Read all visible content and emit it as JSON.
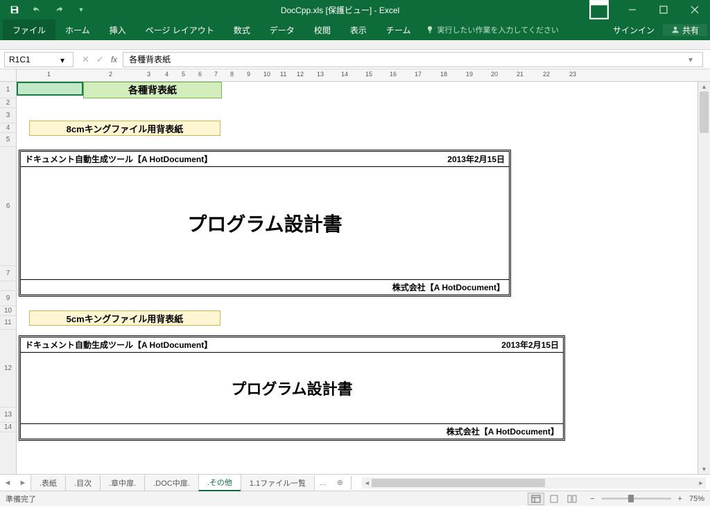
{
  "titlebar": {
    "title": "DocCpp.xls  [保護ビュー] - Excel"
  },
  "ribbon": {
    "file": "ファイル",
    "home": "ホーム",
    "insert": "挿入",
    "pageLayout": "ページ レイアウト",
    "formulas": "数式",
    "data": "データ",
    "review": "校閲",
    "view": "表示",
    "team": "チーム",
    "tellMe": "実行したい作業を入力してください",
    "signIn": "サインイン",
    "share": "共有"
  },
  "formulaBar": {
    "nameBox": "R1C1",
    "value": "各種背表紙"
  },
  "ruler": {
    "ticks": [
      "1",
      "2",
      "3",
      "4",
      "5",
      "6",
      "7",
      "8",
      "9",
      "10",
      "11",
      "12",
      "13",
      "14",
      "15",
      "16",
      "17",
      "18",
      "19",
      "20",
      "21",
      "22",
      "23"
    ]
  },
  "rows": [
    "1",
    "2",
    "3",
    "4",
    "5",
    "6",
    "7",
    "",
    "9",
    "10",
    "11",
    "",
    "12",
    "13",
    "14"
  ],
  "content": {
    "mainTitle": "各種背表紙",
    "sub8cm": "8cmキングファイル用背表紙",
    "sub5cm": "5cmキングファイル用背表紙",
    "box": {
      "toolName": "ドキュメント自動生成ツール【A HotDocument】",
      "date": "2013年2月15日",
      "heading": "プログラム設計書",
      "company": "株式会社【A HotDocument】"
    }
  },
  "sheetTabs": {
    "items": [
      ".表紙",
      ".目次",
      ".章中扉.",
      ".DOC中扉.",
      ".その他",
      "1.1ファイル一覧"
    ],
    "activeIndex": 4,
    "more": "..."
  },
  "statusBar": {
    "ready": "準備完了",
    "zoom": "75%"
  }
}
